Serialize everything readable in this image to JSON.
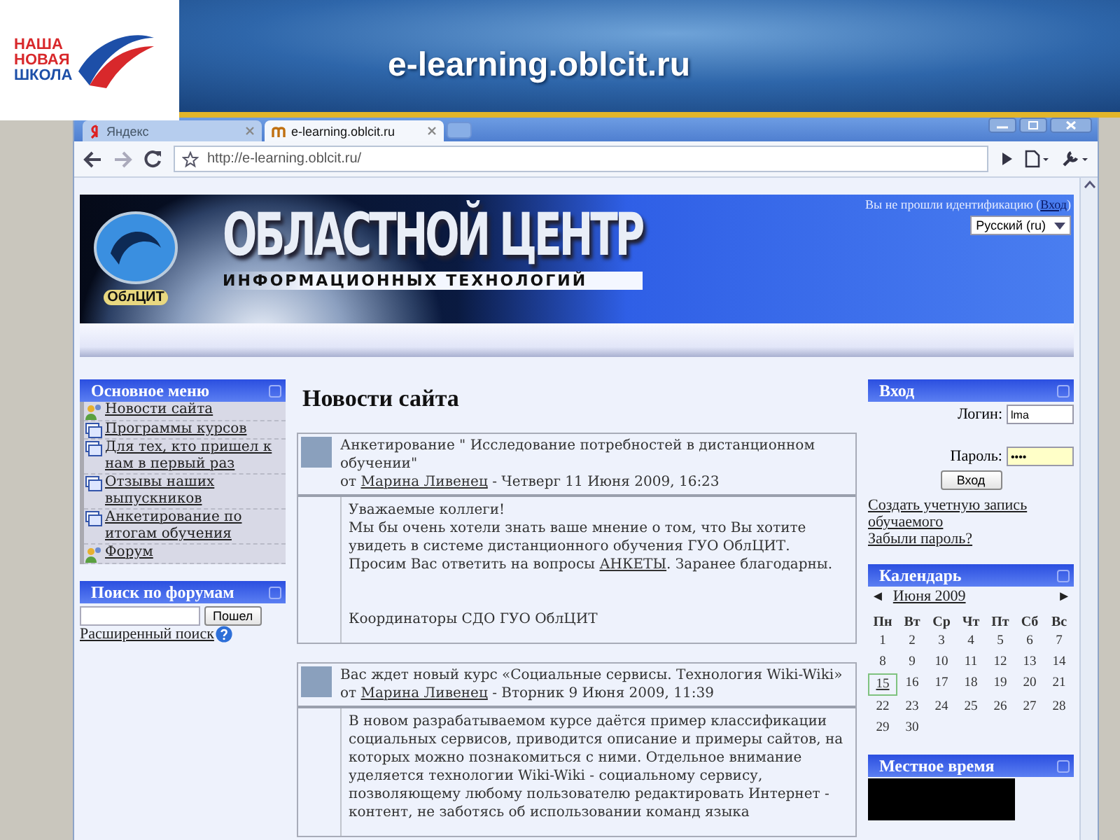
{
  "slide": {
    "logo_lines": [
      "НАША",
      "НОВАЯ",
      "ШКОЛА"
    ],
    "title": "e-learning.oblcit.ru"
  },
  "browser": {
    "tabs": [
      {
        "label": "Яндекс",
        "selected": false
      },
      {
        "label": "e-learning.oblcit.ru",
        "selected": true
      }
    ],
    "address": "http://e-learning.oblcit.ru/"
  },
  "header": {
    "logo_caption": "ОблЦИТ",
    "title": "ОБЛАСТНОЙ ЦЕНТР",
    "subtitle": "ИНФОРМАЦИОННЫХ ТЕХНОЛОГИЙ",
    "login_notice": "Вы не прошли идентификацию (",
    "login_link": "Вход",
    "login_notice_end": ")",
    "language": "Русский (ru)"
  },
  "main_menu": {
    "title": "Основное меню",
    "items": [
      {
        "label": "Новости сайта",
        "kind": "people"
      },
      {
        "label": "Программы курсов",
        "kind": "page"
      },
      {
        "label": "Для тех, кто пришел к нам в первый раз",
        "kind": "page"
      },
      {
        "label": "Отзывы наших выпускников",
        "kind": "page"
      },
      {
        "label": "Анкетирование по итогам обучения",
        "kind": "page"
      },
      {
        "label": "Форум",
        "kind": "people"
      }
    ]
  },
  "forum_search": {
    "title": "Поиск по форумам",
    "button": "Пошел",
    "advanced_link": "Расширенный поиск"
  },
  "news": {
    "title": "Новости сайта",
    "posts": [
      {
        "subject": "Анкетирование \" Исследование потребностей в дистанционном обучении\"",
        "by": "от",
        "author": "Марина Ливенец",
        "date": "- Четверг 11 Июня 2009, 16:23",
        "paragraphs": [
          {
            "kind": "text",
            "segments": [
              {
                "text": "Уважаемые коллеги!",
                "kind": "text"
              }
            ]
          },
          {
            "kind": "text",
            "segments": [
              {
                "text": "Мы бы очень хотели знать ваше мнение о том, что Вы хотите увидеть в системе дистанционного обучения ГУО ОблЦИТ. Просим Вас ответить на вопросы ",
                "kind": "text"
              },
              {
                "text": "АНКЕТЫ",
                "kind": "link"
              },
              {
                "text": ". Заранее благодарны.",
                "kind": "text"
              }
            ]
          },
          {
            "kind": "signature",
            "segments": [
              {
                "text": "Координаторы СДО ГУО ОблЦИТ",
                "kind": "text"
              }
            ]
          }
        ]
      },
      {
        "subject": "Вас ждет новый курс «Социальные сервисы. Технология Wiki-Wiki»",
        "by": "от",
        "author": "Марина Ливенец",
        "date": "- Вторник 9 Июня 2009, 11:39",
        "paragraphs": [
          {
            "kind": "text",
            "segments": [
              {
                "text": "В новом разрабатываемом курсе даётся пример классификации социальных сервисов, приводится описание и примеры сайтов, на которых можно познакомиться с ними. Отдельное внимание уделяется технологии Wiki-Wiki - социальному сервису, позволяющему любому пользователю редактировать Интернет - контент, не заботясь об использовании команд языка",
                "kind": "text"
              }
            ]
          }
        ]
      }
    ]
  },
  "login": {
    "title": "Вход",
    "username_label": "Логин:",
    "username_value": "lma",
    "password_label": "Пароль:",
    "password_value": "••••",
    "button": "Вход",
    "links": [
      "Создать учетную запись обучаемого",
      "Забыли пароль?"
    ]
  },
  "calendar": {
    "title": "Календарь",
    "prev": "◄",
    "month": "Июня 2009",
    "next": "►",
    "weekdays": [
      "Пн",
      "Вт",
      "Ср",
      "Чт",
      "Пт",
      "Сб",
      "Вс"
    ],
    "days": [
      {
        "label": "1",
        "today": false
      },
      {
        "label": "2",
        "today": false
      },
      {
        "label": "3",
        "today": false
      },
      {
        "label": "4",
        "today": false
      },
      {
        "label": "5",
        "today": false
      },
      {
        "label": "6",
        "today": false
      },
      {
        "label": "7",
        "today": false
      },
      {
        "label": "8",
        "today": false
      },
      {
        "label": "9",
        "today": false
      },
      {
        "label": "10",
        "today": false
      },
      {
        "label": "11",
        "today": false
      },
      {
        "label": "12",
        "today": false
      },
      {
        "label": "13",
        "today": false
      },
      {
        "label": "14",
        "today": false
      },
      {
        "label": "15",
        "today": true
      },
      {
        "label": "16",
        "today": false
      },
      {
        "label": "17",
        "today": false
      },
      {
        "label": "18",
        "today": false
      },
      {
        "label": "19",
        "today": false
      },
      {
        "label": "20",
        "today": false
      },
      {
        "label": "21",
        "today": false
      },
      {
        "label": "22",
        "today": false
      },
      {
        "label": "23",
        "today": false
      },
      {
        "label": "24",
        "today": false
      },
      {
        "label": "25",
        "today": false
      },
      {
        "label": "26",
        "today": false
      },
      {
        "label": "27",
        "today": false
      },
      {
        "label": "28",
        "today": false
      },
      {
        "label": "29",
        "today": false
      },
      {
        "label": "30",
        "today": false
      }
    ]
  },
  "local_time": {
    "title": "Местное время"
  }
}
